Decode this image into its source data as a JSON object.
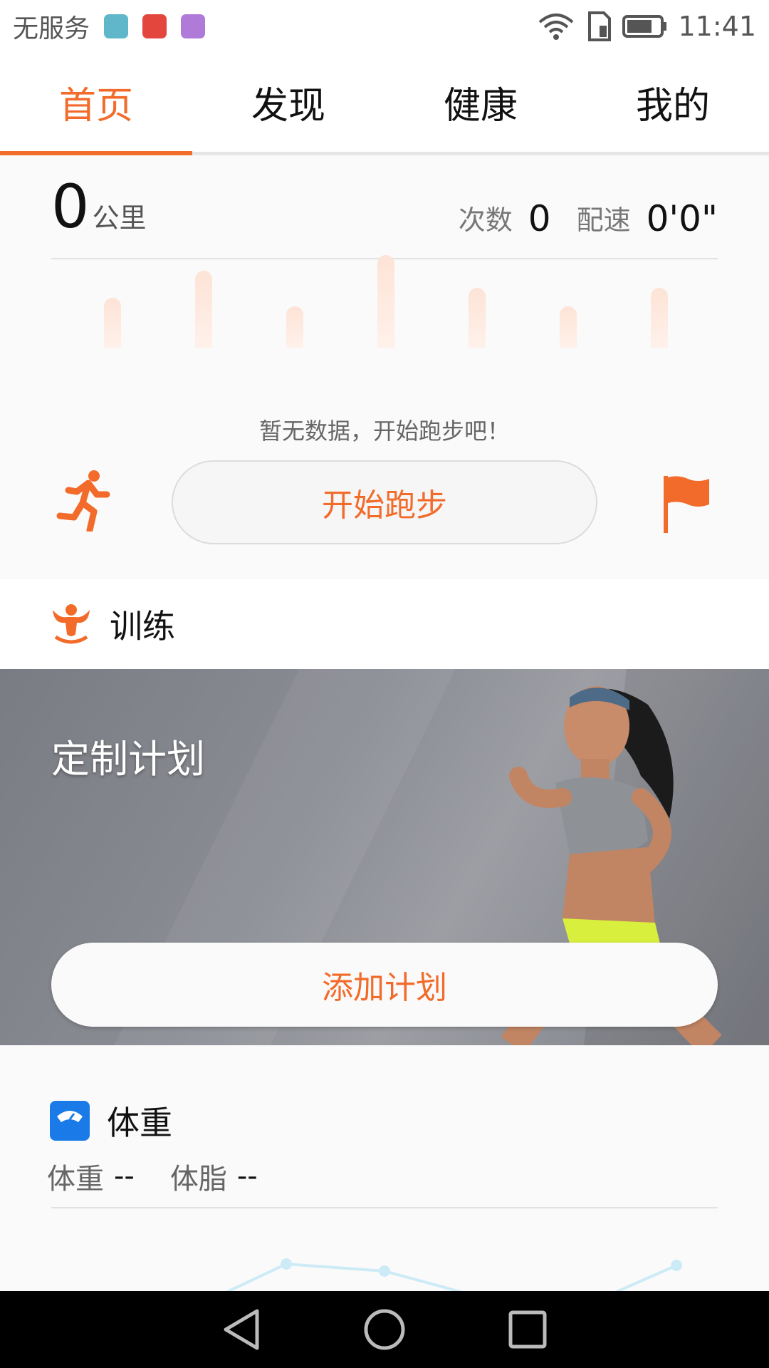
{
  "status_bar": {
    "carrier": "无服务",
    "time": "11:41"
  },
  "tabs": [
    {
      "label": "首页",
      "active": true
    },
    {
      "label": "发现",
      "active": false
    },
    {
      "label": "健康",
      "active": false
    },
    {
      "label": "我的",
      "active": false
    }
  ],
  "run": {
    "distance": "0",
    "distance_unit": "公里",
    "count_label": "次数",
    "count_value": "0",
    "pace_label": "配速",
    "pace_value": "0'0\"",
    "empty_tip": "暂无数据，开始跑步吧！",
    "start_button": "开始跑步"
  },
  "training": {
    "title": "训练",
    "banner_title": "定制计划",
    "add_button": "添加计划"
  },
  "weight": {
    "title": "体重",
    "weight_label": "体重",
    "weight_value": "--",
    "fat_label": "体脂",
    "fat_value": "--"
  },
  "colors": {
    "accent": "#f26b2a",
    "weight_icon": "#1a7be8"
  }
}
